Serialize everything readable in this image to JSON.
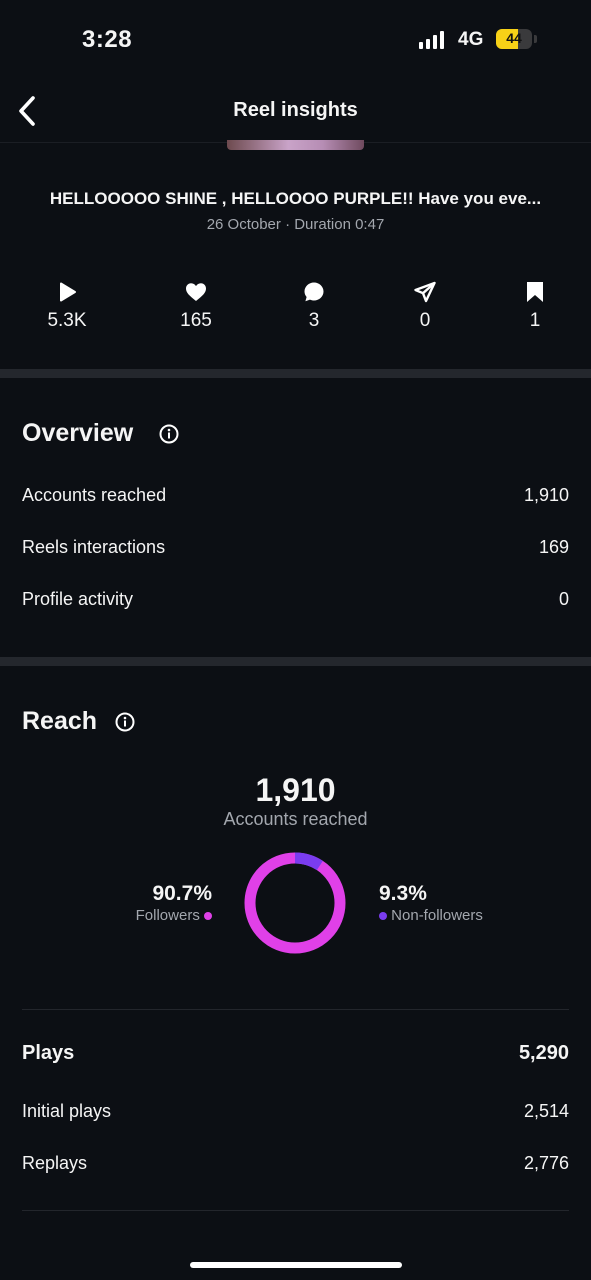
{
  "status_bar": {
    "time": "3:28",
    "network": "4G",
    "battery": "44"
  },
  "header": {
    "title": "Reel insights"
  },
  "reel": {
    "caption": "HELLOOOOO SHINE , HELLOOOO PURPLE!! Have you eve...",
    "meta": "26 October · Duration 0:47"
  },
  "stats": {
    "plays": "5.3K",
    "likes": "165",
    "comments": "3",
    "shares": "0",
    "saves": "1"
  },
  "overview": {
    "title": "Overview",
    "rows": [
      {
        "label": "Accounts reached",
        "value": "1,910"
      },
      {
        "label": "Reels interactions",
        "value": "169"
      },
      {
        "label": "Profile activity",
        "value": "0"
      }
    ]
  },
  "reach": {
    "title": "Reach",
    "total": "1,910",
    "total_label": "Accounts reached",
    "followers_pct": "90.7%",
    "followers_label": "Followers",
    "nonfollowers_pct": "9.3%",
    "nonfollowers_label": "Non-followers",
    "followers_fraction": 0.907,
    "colors": {
      "followers": "#e040e8",
      "nonfollowers": "#7a3cf0"
    }
  },
  "plays": {
    "title": "Plays",
    "total": "5,290",
    "rows": [
      {
        "label": "Initial plays",
        "value": "2,514"
      },
      {
        "label": "Replays",
        "value": "2,776"
      }
    ]
  }
}
